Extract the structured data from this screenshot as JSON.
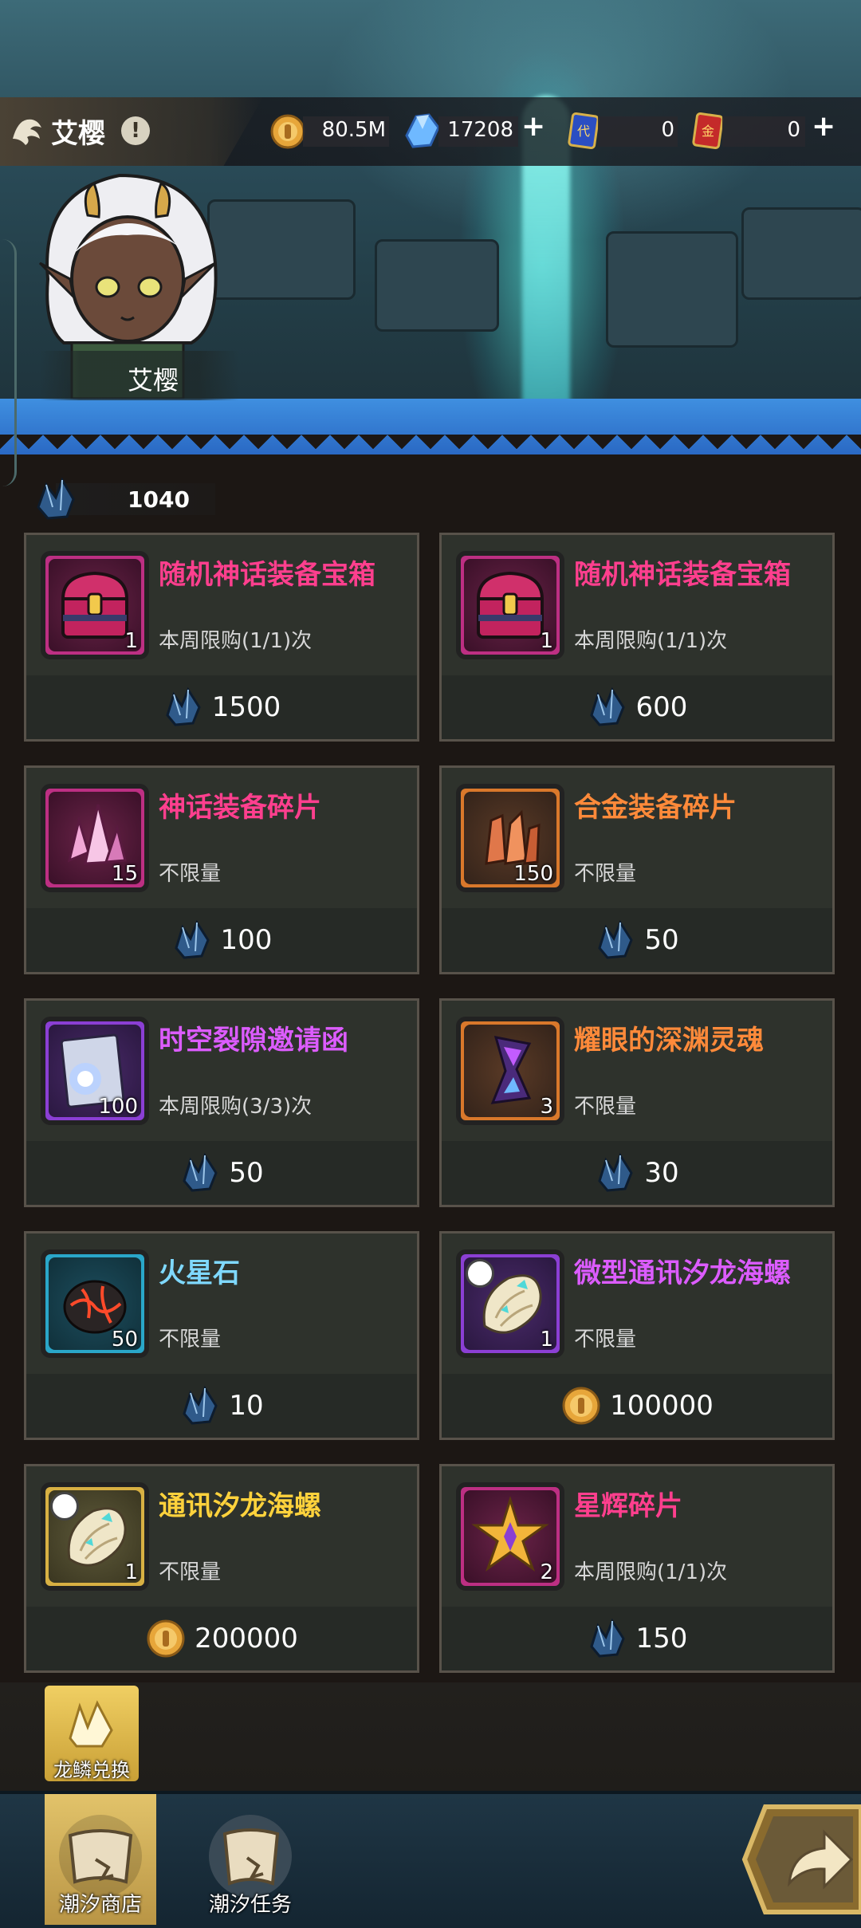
{
  "character": {
    "name": "艾樱",
    "portrait_label": "艾樱"
  },
  "resources": [
    {
      "icon": "gold-coin-icon",
      "value": "80.5M",
      "has_plus": false
    },
    {
      "icon": "crystal-icon",
      "value": "17208",
      "has_plus": true
    },
    {
      "icon": "blue-ticket-icon",
      "value": "0",
      "has_plus": false
    },
    {
      "icon": "red-ticket-icon",
      "value": "0",
      "has_plus": true
    }
  ],
  "dragon_scale_balance": "1040",
  "shop_items": [
    {
      "title": "随机神话装备宝箱",
      "count": "1",
      "limit": "本周限购(1/1)次",
      "price": "1500",
      "currency": "dragon-scale",
      "rarity": "pink",
      "icon": "chest-icon"
    },
    {
      "title": "随机神话装备宝箱",
      "count": "1",
      "limit": "本周限购(1/1)次",
      "price": "600",
      "currency": "dragon-scale",
      "rarity": "pink",
      "icon": "chest-icon"
    },
    {
      "title": "神话装备碎片",
      "count": "15",
      "limit": "不限量",
      "price": "100",
      "currency": "dragon-scale",
      "rarity": "pink",
      "icon": "crystal-shard-icon"
    },
    {
      "title": "合金装备碎片",
      "count": "150",
      "limit": "不限量",
      "price": "50",
      "currency": "dragon-scale",
      "rarity": "orange",
      "icon": "alloy-shard-icon"
    },
    {
      "title": "时空裂隙邀请函",
      "count": "100",
      "limit": "本周限购(3/3)次",
      "price": "50",
      "currency": "dragon-scale",
      "rarity": "purple",
      "icon": "invitation-scroll-icon"
    },
    {
      "title": "耀眼的深渊灵魂",
      "count": "3",
      "limit": "不限量",
      "price": "30",
      "currency": "dragon-scale",
      "rarity": "orange",
      "icon": "hourglass-soul-icon"
    },
    {
      "title": "火星石",
      "count": "50",
      "limit": "不限量",
      "price": "10",
      "currency": "dragon-scale",
      "rarity": "blue",
      "icon": "mars-stone-icon"
    },
    {
      "title": "微型通讯汐龙海螺",
      "count": "1",
      "limit": "不限量",
      "price": "100000",
      "currency": "gold",
      "rarity": "purple",
      "icon": "conch-shell-icon",
      "timed": true
    },
    {
      "title": "通讯汐龙海螺",
      "count": "1",
      "limit": "不限量",
      "price": "200000",
      "currency": "gold",
      "rarity": "gold",
      "icon": "conch-shell-icon",
      "timed": true
    },
    {
      "title": "星辉碎片",
      "count": "2",
      "limit": "本周限购(1/1)次",
      "price": "150",
      "currency": "dragon-scale",
      "rarity": "pink",
      "icon": "star-shard-icon"
    }
  ],
  "exchange_button": {
    "label": "龙鳞兑换"
  },
  "tabs": [
    {
      "label": "潮汐商店",
      "active": true
    },
    {
      "label": "潮汐任务",
      "active": false
    }
  ]
}
